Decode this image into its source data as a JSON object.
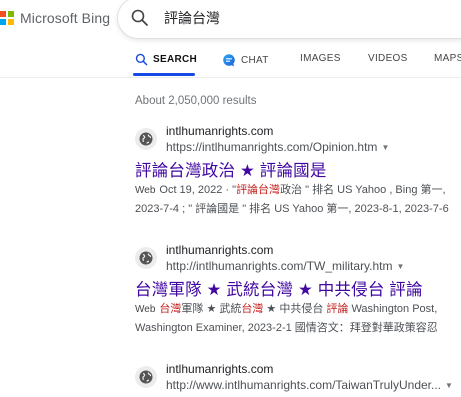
{
  "header": {
    "logo_text": "Microsoft Bing",
    "search_query": "評論台灣"
  },
  "tabs": [
    {
      "label": "SEARCH",
      "active": true
    },
    {
      "label": "CHAT",
      "active": false
    },
    {
      "label": "IMAGES",
      "active": false
    },
    {
      "label": "VIDEOS",
      "active": false
    },
    {
      "label": "MAPS",
      "active": false
    }
  ],
  "results_count": "About 2,050,000 results",
  "results": [
    {
      "site": "intlhumanrights.com",
      "url": "https://intlhumanrights.com/Opinion.htm",
      "title": "評論台灣政治 ★ 評論國是",
      "web_tag": "Web",
      "snippet_line1_pre": "Oct 19, 2022 · \"",
      "snippet_line1_hl": "評論台灣",
      "snippet_line1_post": "政治 \" 排名 US Yahoo , Bing 第一,",
      "snippet_line2": "2023-7-4 ; \" 評論國是 \" 排名 US Yahoo 第一, 2023-8-1, 2023-7-6"
    },
    {
      "site": "intlhumanrights.com",
      "url": "http://intlhumanrights.com/TW_military.htm",
      "title": "台灣軍隊 ★ 武統台灣 ★ 中共侵台 評論",
      "web_tag": "Web",
      "snippet_line1_hl1": "台灣",
      "snippet_line1_mid1": "軍隊 ★ 武統",
      "snippet_line1_hl2": "台灣",
      "snippet_line1_mid2": " ★ 中共侵台 ",
      "snippet_line1_hl3": "評論",
      "snippet_line1_post": " Washington Post,",
      "snippet_line2": "Washington Examiner, 2023-2-1 國情咨文：拜登對華政策容忍"
    },
    {
      "site": "intlhumanrights.com",
      "url": "http://www.intlhumanrights.com/TaiwanTrulyUnder..."
    }
  ],
  "colors": {
    "accent": "#174ae4",
    "link_visited": "#4007a2",
    "highlight": "#c5221f"
  },
  "icons": {
    "search": "magnifier",
    "chat": "chat-bubble",
    "favicon": "globe"
  }
}
